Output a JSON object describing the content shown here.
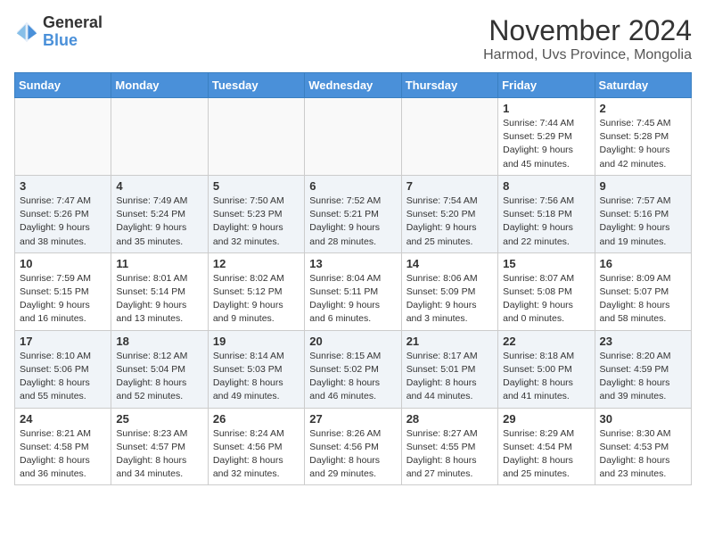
{
  "logo": {
    "line1": "General",
    "line2": "Blue"
  },
  "title": "November 2024",
  "location": "Harmod, Uvs Province, Mongolia",
  "days_of_week": [
    "Sunday",
    "Monday",
    "Tuesday",
    "Wednesday",
    "Thursday",
    "Friday",
    "Saturday"
  ],
  "weeks": [
    [
      {
        "day": "",
        "info": ""
      },
      {
        "day": "",
        "info": ""
      },
      {
        "day": "",
        "info": ""
      },
      {
        "day": "",
        "info": ""
      },
      {
        "day": "",
        "info": ""
      },
      {
        "day": "1",
        "info": "Sunrise: 7:44 AM\nSunset: 5:29 PM\nDaylight: 9 hours\nand 45 minutes."
      },
      {
        "day": "2",
        "info": "Sunrise: 7:45 AM\nSunset: 5:28 PM\nDaylight: 9 hours\nand 42 minutes."
      }
    ],
    [
      {
        "day": "3",
        "info": "Sunrise: 7:47 AM\nSunset: 5:26 PM\nDaylight: 9 hours\nand 38 minutes."
      },
      {
        "day": "4",
        "info": "Sunrise: 7:49 AM\nSunset: 5:24 PM\nDaylight: 9 hours\nand 35 minutes."
      },
      {
        "day": "5",
        "info": "Sunrise: 7:50 AM\nSunset: 5:23 PM\nDaylight: 9 hours\nand 32 minutes."
      },
      {
        "day": "6",
        "info": "Sunrise: 7:52 AM\nSunset: 5:21 PM\nDaylight: 9 hours\nand 28 minutes."
      },
      {
        "day": "7",
        "info": "Sunrise: 7:54 AM\nSunset: 5:20 PM\nDaylight: 9 hours\nand 25 minutes."
      },
      {
        "day": "8",
        "info": "Sunrise: 7:56 AM\nSunset: 5:18 PM\nDaylight: 9 hours\nand 22 minutes."
      },
      {
        "day": "9",
        "info": "Sunrise: 7:57 AM\nSunset: 5:16 PM\nDaylight: 9 hours\nand 19 minutes."
      }
    ],
    [
      {
        "day": "10",
        "info": "Sunrise: 7:59 AM\nSunset: 5:15 PM\nDaylight: 9 hours\nand 16 minutes."
      },
      {
        "day": "11",
        "info": "Sunrise: 8:01 AM\nSunset: 5:14 PM\nDaylight: 9 hours\nand 13 minutes."
      },
      {
        "day": "12",
        "info": "Sunrise: 8:02 AM\nSunset: 5:12 PM\nDaylight: 9 hours\nand 9 minutes."
      },
      {
        "day": "13",
        "info": "Sunrise: 8:04 AM\nSunset: 5:11 PM\nDaylight: 9 hours\nand 6 minutes."
      },
      {
        "day": "14",
        "info": "Sunrise: 8:06 AM\nSunset: 5:09 PM\nDaylight: 9 hours\nand 3 minutes."
      },
      {
        "day": "15",
        "info": "Sunrise: 8:07 AM\nSunset: 5:08 PM\nDaylight: 9 hours\nand 0 minutes."
      },
      {
        "day": "16",
        "info": "Sunrise: 8:09 AM\nSunset: 5:07 PM\nDaylight: 8 hours\nand 58 minutes."
      }
    ],
    [
      {
        "day": "17",
        "info": "Sunrise: 8:10 AM\nSunset: 5:06 PM\nDaylight: 8 hours\nand 55 minutes."
      },
      {
        "day": "18",
        "info": "Sunrise: 8:12 AM\nSunset: 5:04 PM\nDaylight: 8 hours\nand 52 minutes."
      },
      {
        "day": "19",
        "info": "Sunrise: 8:14 AM\nSunset: 5:03 PM\nDaylight: 8 hours\nand 49 minutes."
      },
      {
        "day": "20",
        "info": "Sunrise: 8:15 AM\nSunset: 5:02 PM\nDaylight: 8 hours\nand 46 minutes."
      },
      {
        "day": "21",
        "info": "Sunrise: 8:17 AM\nSunset: 5:01 PM\nDaylight: 8 hours\nand 44 minutes."
      },
      {
        "day": "22",
        "info": "Sunrise: 8:18 AM\nSunset: 5:00 PM\nDaylight: 8 hours\nand 41 minutes."
      },
      {
        "day": "23",
        "info": "Sunrise: 8:20 AM\nSunset: 4:59 PM\nDaylight: 8 hours\nand 39 minutes."
      }
    ],
    [
      {
        "day": "24",
        "info": "Sunrise: 8:21 AM\nSunset: 4:58 PM\nDaylight: 8 hours\nand 36 minutes."
      },
      {
        "day": "25",
        "info": "Sunrise: 8:23 AM\nSunset: 4:57 PM\nDaylight: 8 hours\nand 34 minutes."
      },
      {
        "day": "26",
        "info": "Sunrise: 8:24 AM\nSunset: 4:56 PM\nDaylight: 8 hours\nand 32 minutes."
      },
      {
        "day": "27",
        "info": "Sunrise: 8:26 AM\nSunset: 4:56 PM\nDaylight: 8 hours\nand 29 minutes."
      },
      {
        "day": "28",
        "info": "Sunrise: 8:27 AM\nSunset: 4:55 PM\nDaylight: 8 hours\nand 27 minutes."
      },
      {
        "day": "29",
        "info": "Sunrise: 8:29 AM\nSunset: 4:54 PM\nDaylight: 8 hours\nand 25 minutes."
      },
      {
        "day": "30",
        "info": "Sunrise: 8:30 AM\nSunset: 4:53 PM\nDaylight: 8 hours\nand 23 minutes."
      }
    ]
  ]
}
